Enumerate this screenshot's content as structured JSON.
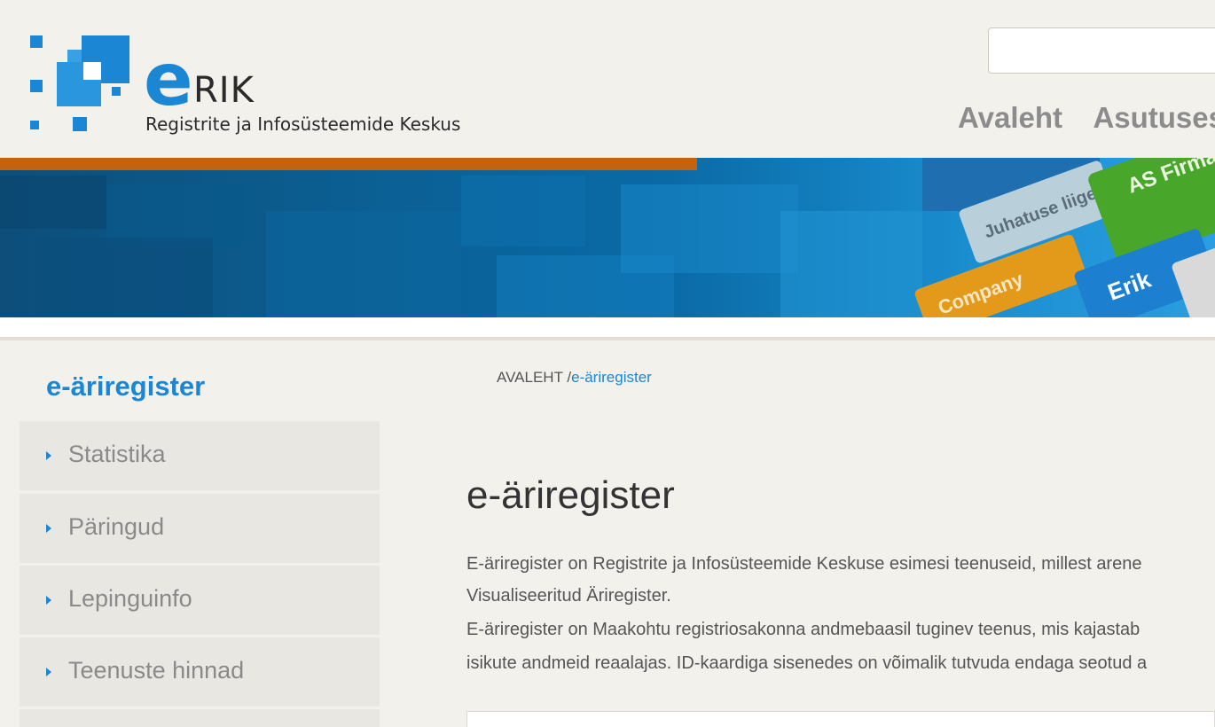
{
  "header": {
    "logo_e": "e",
    "logo_rik": "RIK",
    "logo_subtitle": "Registrite ja Infosüsteemide Keskus",
    "search": {
      "value": "",
      "placeholder": ""
    },
    "nav": [
      "Avaleht",
      "Asutusest"
    ]
  },
  "banner": {
    "tags": [
      "Juhatuse liige",
      "AS Firma",
      "Company",
      "Erik"
    ]
  },
  "sidebar": {
    "title": "e-äriregister",
    "items": [
      "Statistika",
      "Päringud",
      "Lepinguinfo",
      "Teenuste hinnad"
    ]
  },
  "breadcrumb": {
    "home": "AVALEHT",
    "separator": "/",
    "current": "e-äriregister"
  },
  "main": {
    "title": "e-äriregister",
    "paragraph_lines": [
      "E-äriregister on Registrite ja Infosüsteemide Keskuse esimesi teenuseid, millest arene",
      "Visualiseeritud Äriregister.",
      "E-äriregister on Maakohtu registriosakonna andmebaasil tuginev teenus, mis kajastab",
      "isikute andmeid reaalajas. ID-kaardiga sisenedes on võimalik tutvuda endaga seotud a"
    ]
  },
  "colors": {
    "accent": "#1b86d3",
    "orange": "#c4620e",
    "background": "#f3f1ec"
  }
}
